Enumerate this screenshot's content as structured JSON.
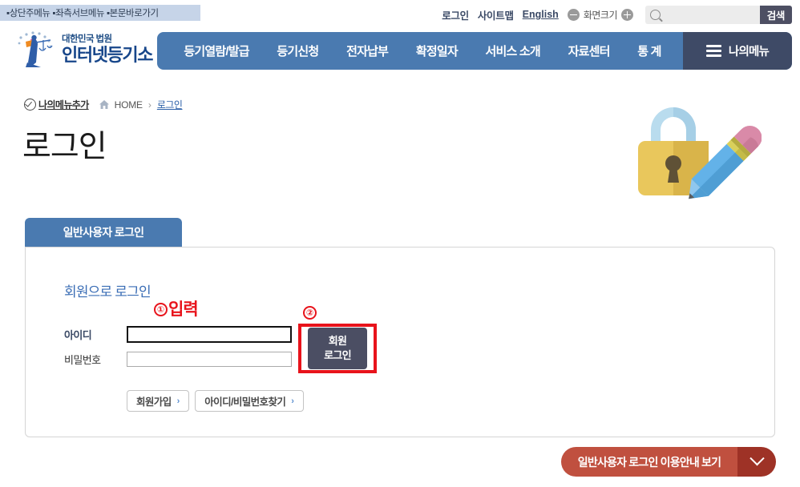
{
  "skip_nav": {
    "items": [
      "상단주메뉴",
      "좌측서브메뉴",
      "본문바로가기"
    ]
  },
  "utility": {
    "login": "로그인",
    "sitemap": "사이트맵",
    "english": "English",
    "zoom_label": "화면크기",
    "zoom_out_icon": "minus-circle-icon",
    "zoom_in_icon": "plus-circle-icon",
    "search_placeholder": "",
    "search_value": "",
    "search_icon": "magnifier-icon",
    "search_button": "검색"
  },
  "header": {
    "logo_sub": "대한민국 법원",
    "logo_main": "인터넷등기소",
    "logo_icon": "court-scales-logo-icon"
  },
  "gnb": {
    "items": [
      "등기열람/발급",
      "등기신청",
      "전자납부",
      "확정일자",
      "서비스 소개",
      "자료센터",
      "통 계"
    ],
    "my_menu": "나의메뉴",
    "my_menu_icon": "hamburger-icon"
  },
  "breadcrumb": {
    "add_mymenu": "나의메뉴추가",
    "add_mymenu_icon": "check-circle-icon",
    "home_icon": "home-icon",
    "home": "HOME",
    "separator": "›",
    "current": "로그인"
  },
  "page": {
    "title": "로그인",
    "hero_icon": "padlock-pencil-illustration"
  },
  "login_panel": {
    "tab_label": "일반사용자 로그인",
    "heading": "회원으로 로그인",
    "fields": [
      {
        "label": "아이디",
        "value": "",
        "placeholder": "",
        "focused": true
      },
      {
        "label": "비밀번호",
        "value": "",
        "placeholder": "",
        "focused": false
      }
    ],
    "submit_line1": "회원",
    "submit_line2": "로그인",
    "sub_buttons": [
      {
        "label": "회원가입",
        "arrow": "›"
      },
      {
        "label": "아이디/비밀번호찾기",
        "arrow": "›"
      }
    ]
  },
  "annotations": [
    {
      "number": "①",
      "text": "입력"
    },
    {
      "number": "②",
      "text": ""
    }
  ],
  "guide_button": {
    "label": "일반사용자 로그인 이용안내 보기",
    "toggle_icon": "chevron-down-icon"
  },
  "colors": {
    "nav_blue": "#4a7ab0",
    "nav_dark": "#3e4a66",
    "accent_red": "#e8131b",
    "guide_red": "#c0503f",
    "guide_red_dark": "#9e3226",
    "submit_slate": "#4b4e63",
    "link_blue": "#3a6db5"
  }
}
